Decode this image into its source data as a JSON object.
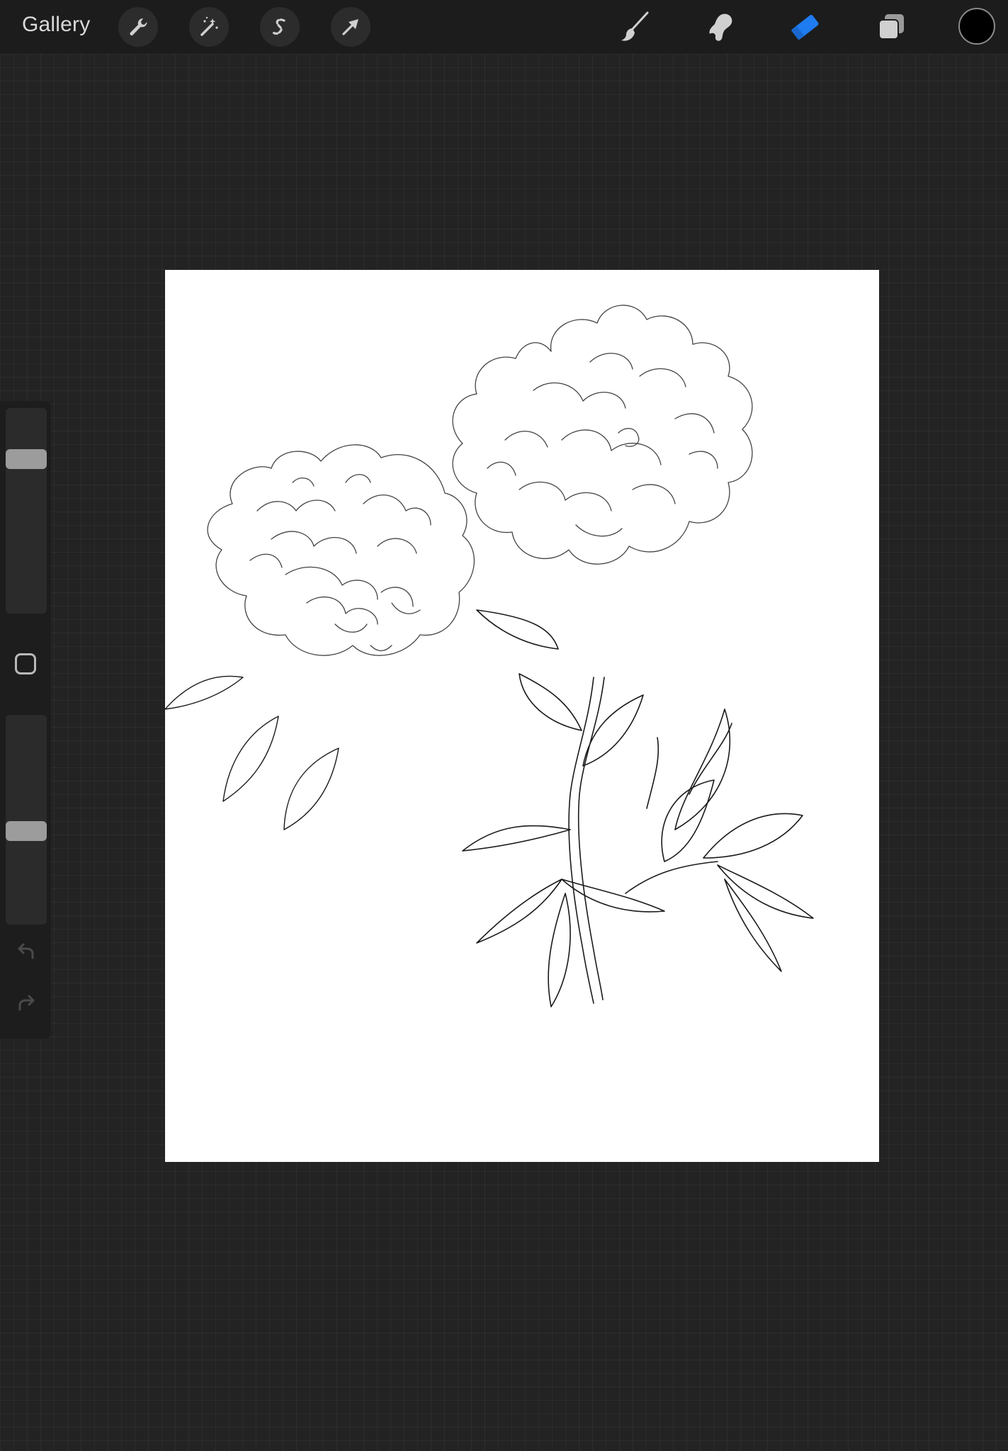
{
  "app": {
    "gallery_label": "Gallery"
  },
  "toolbar": {
    "left_tools": [
      "wrench-icon",
      "magic-wand-icon",
      "selection-s-icon",
      "transform-arrow-icon"
    ],
    "right_tools": [
      "brush-icon",
      "smudge-icon",
      "eraser-icon",
      "layers-icon"
    ],
    "active_tool": "eraser-icon",
    "active_color": "#1f7bf0",
    "current_color": "#000000"
  },
  "sidebar": {
    "brush_size_level": 0.78,
    "opacity_level": 0.44
  }
}
